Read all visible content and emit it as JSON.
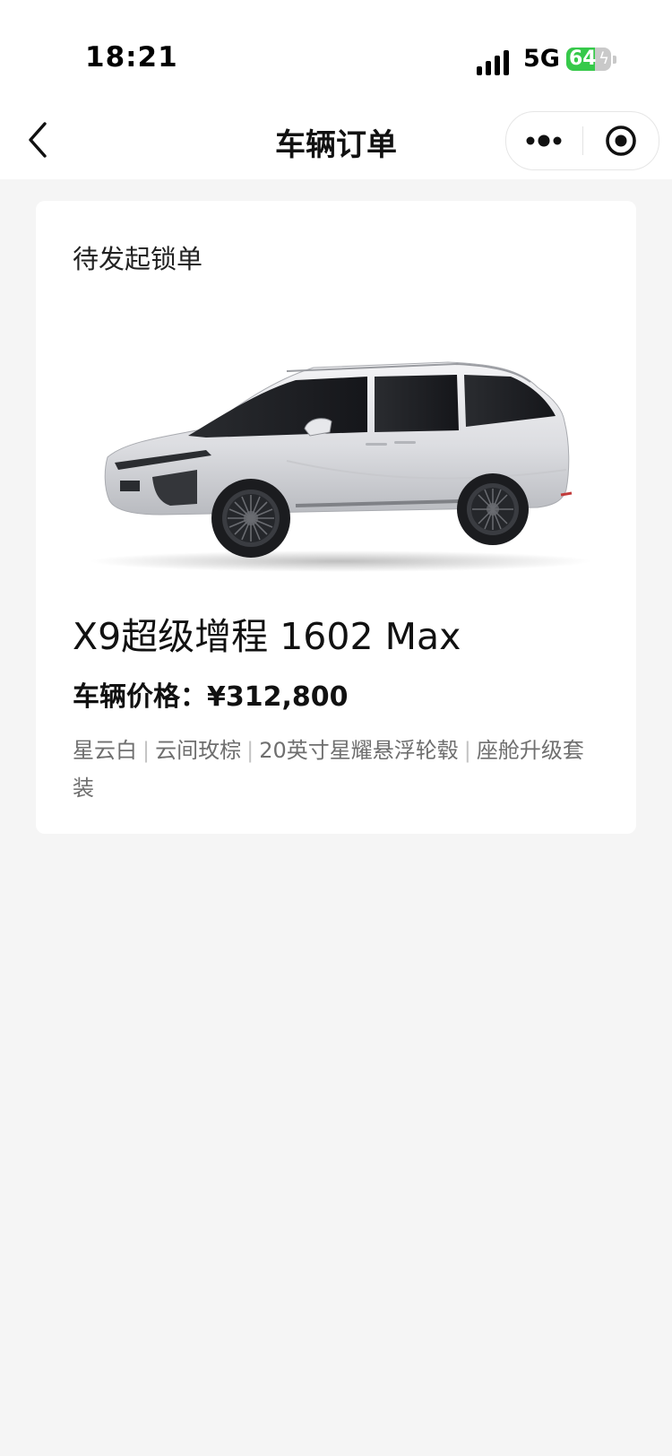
{
  "status_bar": {
    "time": "18:21",
    "network": "5G",
    "battery": "64",
    "battery_level": 0.64,
    "battery_color": "#36c94a"
  },
  "nav": {
    "title": "车辆订单"
  },
  "order": {
    "status": "待发起锁单",
    "model": "X9超级增程 1602 Max",
    "price_label": "车辆价格：",
    "price": "¥312,800",
    "options": [
      "星云白",
      "云间玫棕",
      "20英寸星耀悬浮轮毂",
      "座舱升级套装"
    ],
    "option_separator": "|"
  }
}
